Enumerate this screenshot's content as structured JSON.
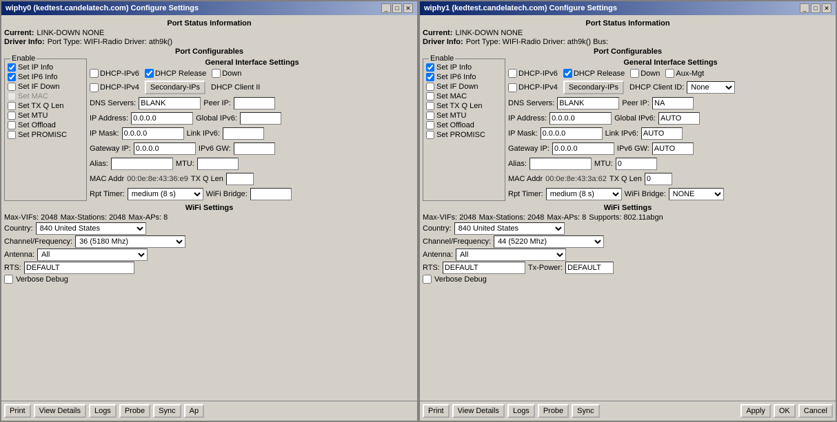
{
  "windows": [
    {
      "id": "wiphy0",
      "title": "wiphy0 (kedtest.candelatech.com) Configure Settings",
      "port_status": {
        "label": "Port Status Information",
        "current_label": "Current:",
        "current_value": "LINK-DOWN  NONE",
        "driver_label": "Driver Info:",
        "driver_value": "Port Type: WIFI-Radio   Driver: ath9k()"
      },
      "port_configurables": {
        "label": "Port Configurables",
        "gen_interface": "General Interface Settings",
        "enable_group": "Enable",
        "checkboxes": [
          {
            "label": "Set IP Info",
            "checked": true
          },
          {
            "label": "Set IP6 Info",
            "checked": true
          },
          {
            "label": "Set IF Down",
            "checked": false
          },
          {
            "label": "Set MAC",
            "checked": false,
            "disabled": true
          },
          {
            "label": "Set TX Q Len",
            "checked": false
          },
          {
            "label": "Set MTU",
            "checked": false
          },
          {
            "label": "Set Offload",
            "checked": false
          },
          {
            "label": "Set PROMISC",
            "checked": false
          }
        ],
        "dhcp_ipv6": {
          "label": "DHCP-IPv6",
          "checked": false
        },
        "dhcp_release": {
          "label": "DHCP Release",
          "checked": true
        },
        "down": {
          "label": "Down",
          "checked": false
        },
        "secondary_ips_btn": "Secondary-IPs",
        "dhcp_client_id_label": "DHCP Client II",
        "dhcp_ipv4": {
          "label": "DHCP-IPv4",
          "checked": false
        },
        "dns_servers_label": "DNS Servers:",
        "dns_servers_value": "BLANK",
        "peer_ip_label": "Peer IP:",
        "peer_ip_value": "",
        "ip_address_label": "IP Address:",
        "ip_address_value": "0.0.0.0",
        "global_ipv6_label": "Global IPv6:",
        "global_ipv6_value": "",
        "ip_mask_label": "IP Mask:",
        "ip_mask_value": "0.0.0.0",
        "link_ipv6_label": "Link IPv6:",
        "link_ipv6_value": "",
        "gateway_ip_label": "Gateway IP:",
        "gateway_ip_value": "0.0.0.0",
        "ipv6_gw_label": "IPv6 GW:",
        "ipv6_gw_value": "",
        "alias_label": "Alias:",
        "alias_value": "",
        "mtu_label": "MTU:",
        "mtu_value": "",
        "mac_addr_label": "MAC Addr",
        "mac_addr_value": "00:0e:8e:43:36:e9",
        "tx_q_len_label": "TX Q Len",
        "tx_q_len_value": "",
        "rpt_timer_label": "Rpt Timer:",
        "rpt_timer_value": "medium  (8 s)",
        "wifi_bridge_label": "WiFi Bridge:",
        "wifi_bridge_value": ""
      },
      "wifi_settings": {
        "label": "WiFi Settings",
        "max_vifs": "Max-VIFs: 2048",
        "max_stations": "Max-Stations: 2048",
        "max_aps": "Max-APs: 8",
        "supports": "",
        "country_label": "Country:",
        "country_value": "840  United States",
        "channel_label": "Channel/Frequency:",
        "channel_value": "36  (5180 Mhz)",
        "antenna_label": "Antenna:",
        "antenna_value": "All",
        "rts_label": "RTS:",
        "rts_value": "DEFAULT",
        "verbose_debug": {
          "label": "Verbose Debug",
          "checked": false
        }
      },
      "bottom_buttons": [
        "Print",
        "View Details",
        "Logs",
        "Probe",
        "Sync",
        "Ap"
      ]
    },
    {
      "id": "wiphy1",
      "title": "wiphy1 (kedtest.candelatech.com) Configure Settings",
      "port_status": {
        "label": "Port Status Information",
        "current_label": "Current:",
        "current_value": "LINK-DOWN  NONE",
        "driver_label": "Driver Info:",
        "driver_value": "Port Type: WIFI-Radio   Driver: ath9k()  Bus:"
      },
      "port_configurables": {
        "label": "Port Configurables",
        "gen_interface": "General Interface Settings",
        "enable_group": "Enable",
        "checkboxes": [
          {
            "label": "Set IP Info",
            "checked": true
          },
          {
            "label": "Set IP6 Info",
            "checked": true
          },
          {
            "label": "Set IF Down",
            "checked": false
          },
          {
            "label": "Set MAC",
            "checked": false,
            "disabled": false
          },
          {
            "label": "Set TX Q Len",
            "checked": false
          },
          {
            "label": "Set MTU",
            "checked": false
          },
          {
            "label": "Set Offload",
            "checked": false
          },
          {
            "label": "Set PROMISC",
            "checked": false
          }
        ],
        "dhcp_ipv6": {
          "label": "DHCP-IPv6",
          "checked": false
        },
        "dhcp_release": {
          "label": "DHCP Release",
          "checked": true
        },
        "down": {
          "label": "Down",
          "checked": false
        },
        "aux_mgt": {
          "label": "Aux-Mgt",
          "checked": false
        },
        "secondary_ips_btn": "Secondary-IPs",
        "dhcp_client_id_label": "DHCP Client ID:",
        "dhcp_client_id_value": "None",
        "dhcp_ipv4": {
          "label": "DHCP-IPv4",
          "checked": false
        },
        "dns_servers_label": "DNS Servers:",
        "dns_servers_value": "BLANK",
        "peer_ip_label": "Peer IP:",
        "peer_ip_value": "NA",
        "ip_address_label": "IP Address:",
        "ip_address_value": "0.0.0.0",
        "global_ipv6_label": "Global IPv6:",
        "global_ipv6_value": "AUTO",
        "ip_mask_label": "IP Mask:",
        "ip_mask_value": "0.0.0.0",
        "link_ipv6_label": "Link IPv6:",
        "link_ipv6_value": "AUTO",
        "gateway_ip_label": "Gateway IP:",
        "gateway_ip_value": "0.0.0.0",
        "ipv6_gw_label": "IPv6 GW:",
        "ipv6_gw_value": "AUTO",
        "alias_label": "Alias:",
        "alias_value": "",
        "mtu_label": "MTU:",
        "mtu_value": "0",
        "mac_addr_label": "MAC Addr",
        "mac_addr_value": "00:0e:8e:43:3a:62",
        "tx_q_len_label": "TX Q Len",
        "tx_q_len_value": "0",
        "rpt_timer_label": "Rpt Timer:",
        "rpt_timer_value": "medium  (8 s)",
        "wifi_bridge_label": "WiFi Bridge:",
        "wifi_bridge_value": "NONE"
      },
      "wifi_settings": {
        "label": "WiFi Settings",
        "max_vifs": "Max-VIFs: 2048",
        "max_stations": "Max-Stations: 2048",
        "max_aps": "Max-APs: 8",
        "supports": "Supports: 802.11abgn",
        "country_label": "Country:",
        "country_value": "840  United States",
        "channel_label": "Channel/Frequency:",
        "channel_value": "44  (5220 Mhz)",
        "antenna_label": "Antenna:",
        "antenna_value": "All",
        "rts_label": "RTS:",
        "rts_value": "DEFAULT",
        "tx_power_label": "Tx-Power:",
        "tx_power_value": "DEFAULT",
        "verbose_debug": {
          "label": "Verbose Debug",
          "checked": false
        }
      },
      "bottom_buttons": [
        "Print",
        "View Details",
        "Logs",
        "Probe",
        "Sync",
        "Apply",
        "OK",
        "Cancel"
      ]
    }
  ]
}
